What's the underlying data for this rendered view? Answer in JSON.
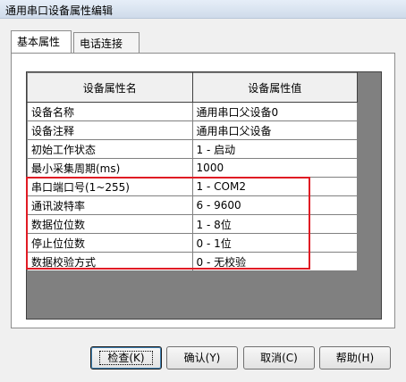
{
  "window": {
    "title": "通用串口设备属性编辑"
  },
  "tabs": [
    {
      "label": "基本属性",
      "active": true
    },
    {
      "label": "电话连接",
      "active": false
    }
  ],
  "table": {
    "headers": [
      "设备属性名",
      "设备属性值"
    ],
    "rows": [
      {
        "name": "设备名称",
        "value": "通用串口父设备0"
      },
      {
        "name": "设备注释",
        "value": "通用串口父设备"
      },
      {
        "name": "初始工作状态",
        "value": "1 - 启动"
      },
      {
        "name": "最小采集周期(ms)",
        "value": "1000"
      },
      {
        "name": "串口端口号(1~255)",
        "value": "1 - COM2"
      },
      {
        "name": "通讯波特率",
        "value": "6 - 9600"
      },
      {
        "name": "数据位位数",
        "value": "1 - 8位"
      },
      {
        "name": "停止位位数",
        "value": "0 - 1位"
      },
      {
        "name": "数据校验方式",
        "value": "0 - 无校验"
      }
    ]
  },
  "buttons": {
    "check": "检查(K)",
    "ok": "确认(Y)",
    "cancel": "取消(C)",
    "help": "帮助(H)"
  },
  "colors": {
    "highlight": "#e01b24",
    "grid_background": "#808080"
  }
}
